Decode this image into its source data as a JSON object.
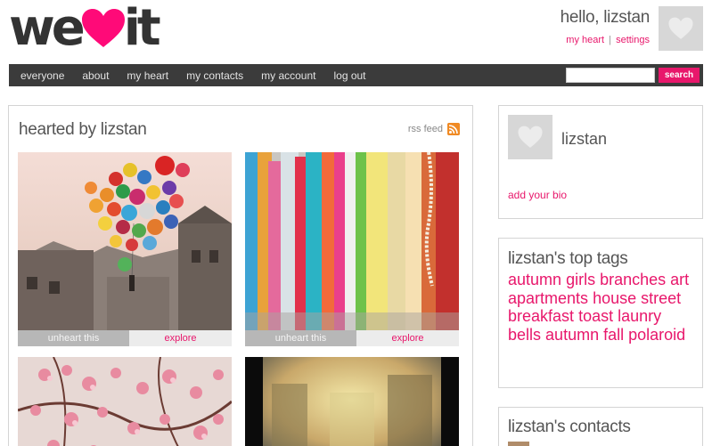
{
  "logo": {
    "left": "we",
    "right": "it"
  },
  "header": {
    "greeting": "hello, lizstan",
    "link_heart": "my heart",
    "link_sep": "|",
    "link_settings": "settings"
  },
  "nav": {
    "items": [
      "everyone",
      "about",
      "my heart",
      "my contacts",
      "my account",
      "log out"
    ],
    "search_value": "",
    "search_button": "search"
  },
  "main": {
    "title": "hearted by lizstan",
    "rss_label": "rss feed",
    "cards": [
      {
        "unheart": "unheart this",
        "explore": "explore"
      },
      {
        "unheart": "unheart this",
        "explore": "explore"
      }
    ]
  },
  "profile": {
    "name": "lizstan",
    "bio_link": "add your bio"
  },
  "tags": {
    "title": "lizstan's top tags",
    "items": [
      "autumn",
      "girls",
      "branches",
      "art",
      "apartments",
      "house",
      "street",
      "breakfast",
      "toast",
      "launry",
      "bells",
      "autumn fall",
      "polaroid"
    ]
  },
  "contacts": {
    "title": "lizstan's contacts"
  },
  "colors": {
    "accent": "#e8176b",
    "nav_bg": "#3b3b3b",
    "text": "#555555"
  },
  "icons": {
    "heart": "heart-icon",
    "rss": "rss-icon",
    "avatar": "avatar-placeholder-icon"
  }
}
